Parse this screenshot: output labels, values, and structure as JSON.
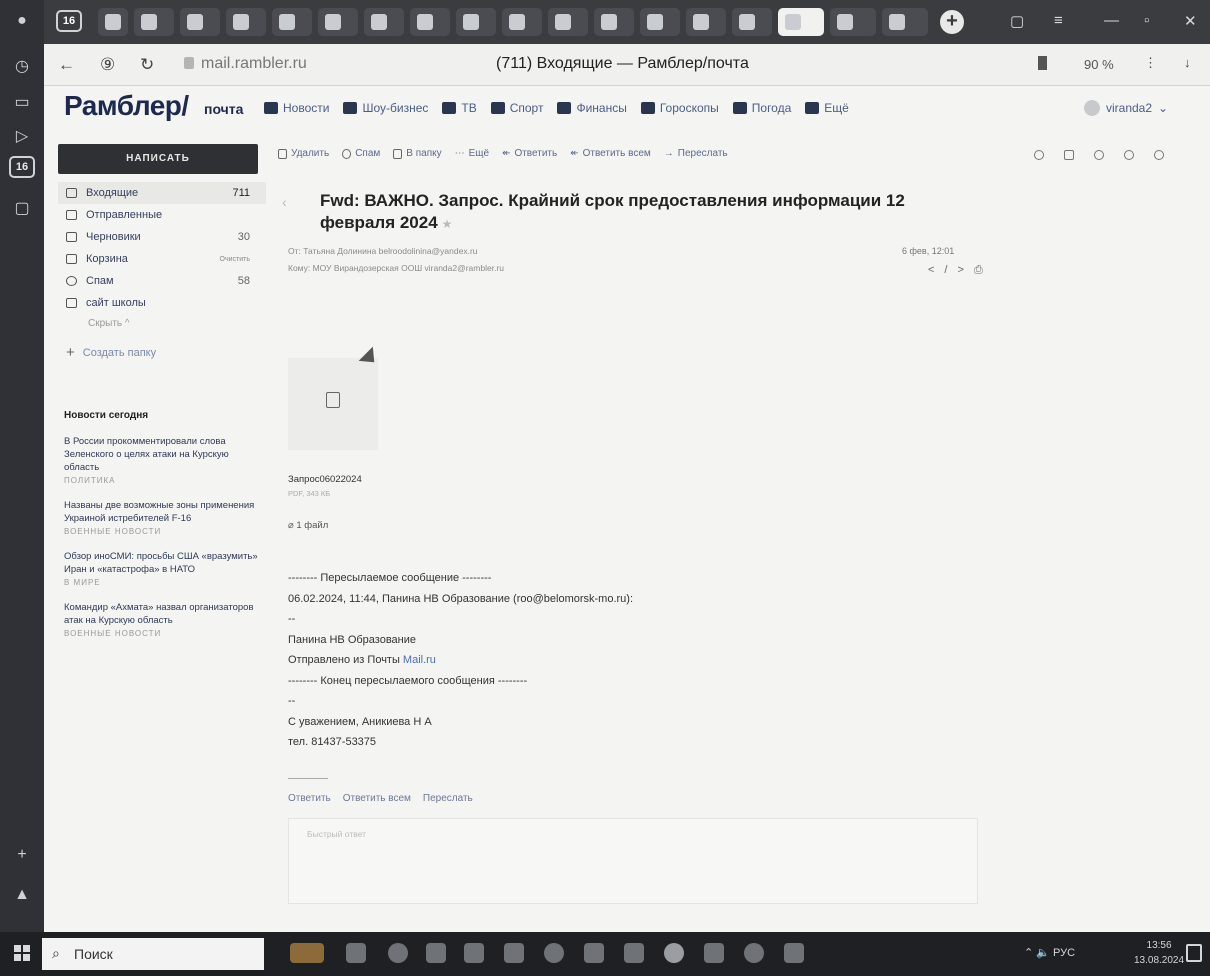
{
  "browser": {
    "tab_count": "16",
    "url_domain": "mail.rambler.ru",
    "page_title": "(711) Входящие — Рамблер/почта",
    "zoom": "90 %"
  },
  "header": {
    "logo": "Рамблер/",
    "logo_sub": "почта",
    "nav": [
      "Новости",
      "Шоу-бизнес",
      "ТВ",
      "Спорт",
      "Финансы",
      "Гороскопы",
      "Погода",
      "Ещё"
    ],
    "user": "viranda2"
  },
  "sidebar": {
    "compose": "НАПИСАТЬ",
    "folders": [
      {
        "label": "Входящие",
        "count": "711"
      },
      {
        "label": "Отправленные",
        "count": ""
      },
      {
        "label": "Черновики",
        "count": "30"
      },
      {
        "label": "Корзина",
        "count": "",
        "action": "Очистить"
      },
      {
        "label": "Спам",
        "count": "58"
      },
      {
        "label": "сайт школы",
        "count": ""
      }
    ],
    "hide": "Скрыть ^",
    "create_folder": "Создать папку"
  },
  "news": {
    "heading": "Новости сегодня",
    "items": [
      {
        "title": "В России прокомментировали слова Зеленского о целях атаки на Курскую область",
        "tag": "ПОЛИТИКА"
      },
      {
        "title": "Названы две возможные зоны применения Украиной истребителей F-16",
        "tag": "ВОЕННЫЕ НОВОСТИ"
      },
      {
        "title": "Обзор иноСМИ: просьбы США «вразумить» Иран и «катастрофа» в НАТО",
        "tag": "В МИРЕ"
      },
      {
        "title": "Командир «Ахмата» назвал организаторов атак на Курскую область",
        "tag": "ВОЕННЫЕ НОВОСТИ"
      }
    ]
  },
  "toolbar": {
    "delete": "Удалить",
    "spam": "Спам",
    "move": "В папку",
    "more": "Ещё",
    "reply": "Ответить",
    "reply_all": "Ответить всем",
    "forward": "Переслать"
  },
  "message": {
    "subject": "Fwd: ВАЖНО. Запрос. Крайний срок предоставления информации 12 февраля 2024",
    "from": "От: Татьяна Долинина belroodolinina@yandex.ru",
    "to": "Кому: МОУ Вирандозерская ООШ viranda2@rambler.ru",
    "date": "6 фев, 12:01",
    "attachment_name": "Запрос06022024",
    "attachment_size": "PDF, 343 КБ",
    "attachment_count": "1 файл",
    "body": {
      "fwd_start": "-------- Пересылаемое сообщение --------",
      "fwd_header": "06.02.2024, 11:44, Панина НВ Образование (roo@belomorsk-mo.ru):",
      "dash1": "--",
      "sender_name": "Панина НВ Образование",
      "sent_from": "Отправлено из Почты ",
      "sent_from_link": "Mail.ru",
      "fwd_end": "-------- Конец пересылаемого сообщения --------",
      "dash2": "--",
      "regards": "С уважением, Аникиева Н А",
      "phone": "тел. 81437-53375"
    },
    "reply_links": [
      "Ответить",
      "Ответить всем",
      "Переслать"
    ],
    "quick_reply_placeholder": "Быстрый ответ"
  },
  "taskbar": {
    "search": "Поиск",
    "lang": "РУС",
    "time": "13:56",
    "date": "13.08.2024"
  }
}
